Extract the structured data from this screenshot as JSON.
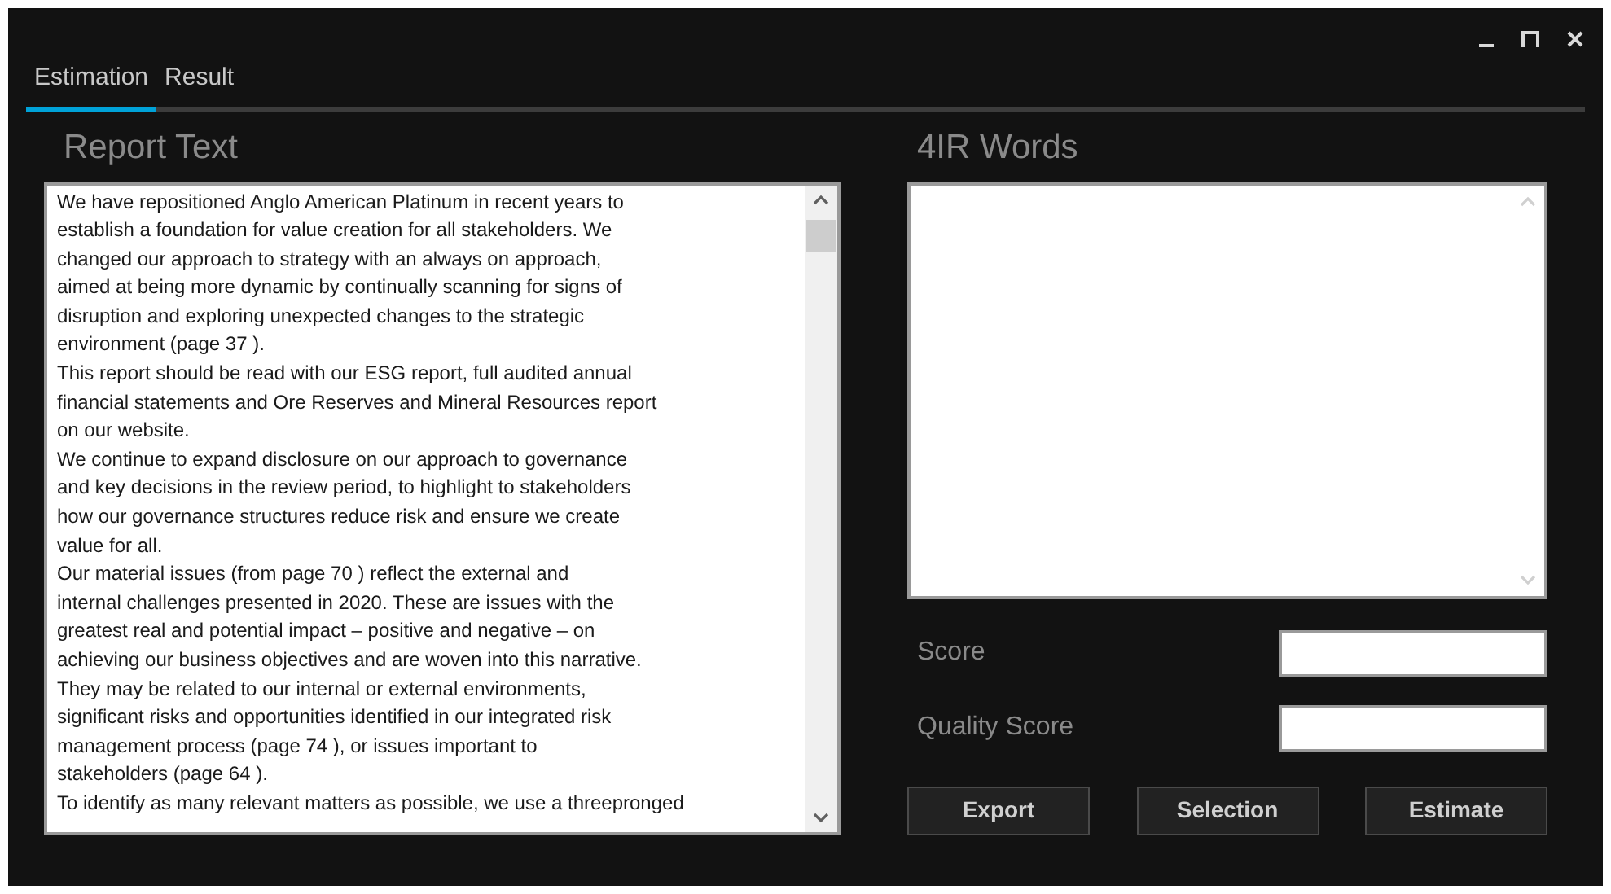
{
  "tabs": [
    {
      "label": "Estimation",
      "selected": true
    },
    {
      "label": "Result",
      "selected": false
    }
  ],
  "report": {
    "title": "Report Text",
    "lines": [
      "We have repositioned Anglo American Platinum in recent years to",
      "establish a foundation for value creation for all stakeholders. We",
      "changed our approach to strategy with an always on approach,",
      "aimed at being more dynamic by continually scanning for signs of",
      "disruption and exploring unexpected changes to the strategic",
      "environment (page 37 ).",
      "This report should be read with our ESG report, full audited annual",
      "financial statements and Ore Reserves and Mineral Resources report",
      "on our website.",
      "We continue to expand disclosure on our approach to governance",
      "and key decisions in the review period, to highlight to stakeholders",
      "how our governance structures reduce risk and ensure we create",
      "value for all.",
      "Our material issues (from page 70 ) reflect the external and",
      "internal challenges presented in 2020. These are issues with the",
      "greatest real and potential impact – positive and negative – on",
      "achieving our business objectives and are woven into this narrative.",
      "They may be related to our internal or external environments,",
      "significant risks and opportunities identified in our integrated risk",
      "management process (page 74 ), or issues important to",
      "stakeholders (page 64 ).",
      "To identify as many relevant matters as possible, we use a threepronged"
    ]
  },
  "words": {
    "title": "4IR Words"
  },
  "fields": [
    {
      "label": "Score"
    },
    {
      "label": "Quality Score"
    }
  ],
  "buttons": [
    "Export",
    "Selection",
    "Estimate"
  ]
}
